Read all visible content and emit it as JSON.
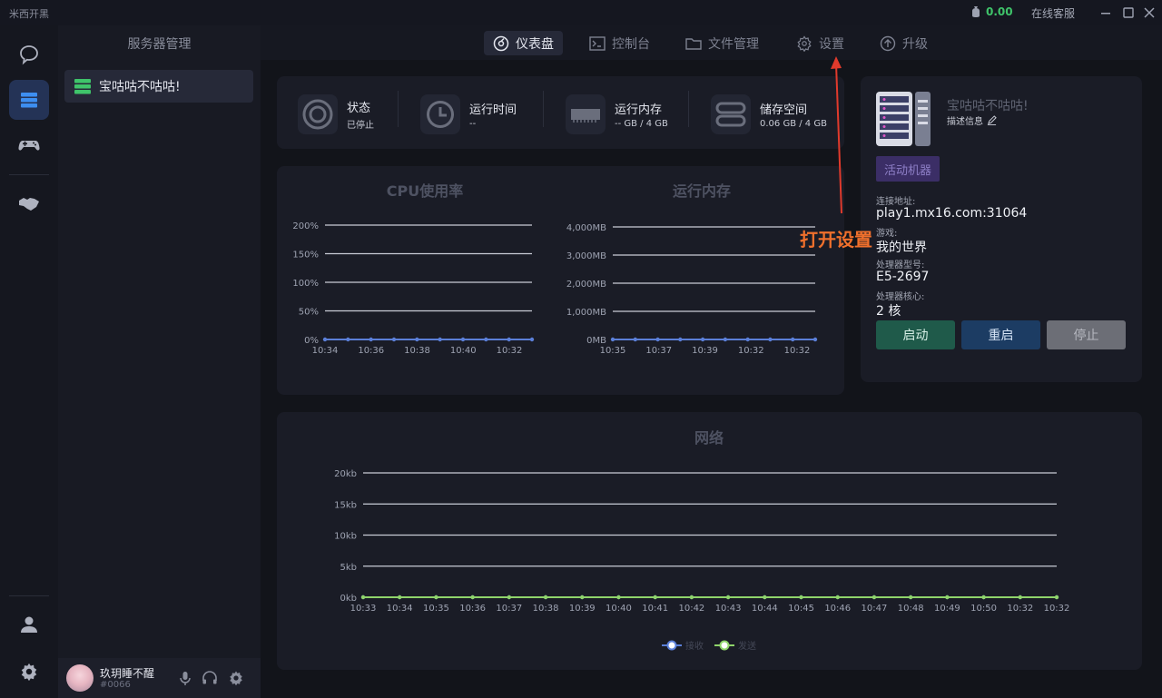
{
  "app": {
    "title": "米西开黑"
  },
  "titlebar": {
    "balance": "0.00",
    "support": "在线客服",
    "balance_color": "#3fc46a"
  },
  "rail": {
    "items": [
      "chat-icon",
      "server-icon",
      "gamepad-icon",
      "handshake-icon"
    ],
    "bottom": [
      "user-icon",
      "gear-icon"
    ]
  },
  "panel": {
    "title": "服务器管理",
    "server": {
      "name": "宝咕咕不咕咕!"
    },
    "user": {
      "name": "玖玥睡不醒",
      "id": "#0066"
    }
  },
  "nav": {
    "tabs": [
      {
        "label": "仪表盘",
        "icon": "dashboard-icon",
        "active": true
      },
      {
        "label": "控制台",
        "icon": "terminal-icon"
      },
      {
        "label": "文件管理",
        "icon": "folder-icon"
      },
      {
        "label": "设置",
        "icon": "gear-icon"
      },
      {
        "label": "升级",
        "icon": "upgrade-icon"
      }
    ]
  },
  "stats": [
    {
      "label": "状态",
      "value": "已停止",
      "icon": "status-icon"
    },
    {
      "label": "运行时间",
      "value": "--",
      "icon": "clock-icon"
    },
    {
      "label": "运行内存",
      "value": "-- GB / 4 GB",
      "icon": "ram-icon"
    },
    {
      "label": "储存空间",
      "value": "0.06 GB / 4 GB",
      "icon": "storage-icon"
    }
  ],
  "chart_data": [
    {
      "type": "line",
      "title": "CPU使用率",
      "x": [
        "10:34",
        "10:36",
        "10:38",
        "10:40",
        "10:32"
      ],
      "y_ticks": [
        "200%",
        "150%",
        "100%",
        "50%",
        "0%"
      ],
      "ylim": [
        0,
        200
      ],
      "series": [
        {
          "values": [
            0,
            0,
            0,
            0,
            0,
            0,
            0,
            0,
            0,
            0
          ],
          "color": "#5b7fd8"
        }
      ],
      "grid": true
    },
    {
      "type": "line",
      "title": "运行内存",
      "x": [
        "10:35",
        "10:37",
        "10:39",
        "10:32",
        "10:32"
      ],
      "y_ticks": [
        "4,000MB",
        "3,000MB",
        "2,000MB",
        "1,000MB",
        "0MB"
      ],
      "ylim": [
        0,
        4000
      ],
      "series": [
        {
          "values": [
            0,
            0,
            0,
            0,
            0,
            0,
            0,
            0,
            0,
            0
          ],
          "color": "#5b7fd8"
        }
      ],
      "grid": true
    },
    {
      "type": "line",
      "title": "网络",
      "x": [
        "10:33",
        "10:34",
        "10:35",
        "10:36",
        "10:37",
        "10:38",
        "10:39",
        "10:40",
        "10:41",
        "10:42",
        "10:43",
        "10:44",
        "10:45",
        "10:46",
        "10:47",
        "10:48",
        "10:49",
        "10:50",
        "10:32",
        "10:32"
      ],
      "y_ticks": [
        "20kb",
        "15kb",
        "10kb",
        "5kb",
        "0kb"
      ],
      "ylim": [
        0,
        20
      ],
      "series": [
        {
          "name": "接收",
          "values": [
            0,
            0,
            0,
            0,
            0,
            0,
            0,
            0,
            0,
            0,
            0,
            0,
            0,
            0,
            0,
            0,
            0,
            0,
            0,
            0
          ],
          "color": "#5b7fd8"
        },
        {
          "name": "发送",
          "values": [
            0,
            0,
            0,
            0,
            0,
            0,
            0,
            0,
            0,
            0,
            0,
            0,
            0,
            0,
            0,
            0,
            0,
            0,
            0,
            0
          ],
          "color": "#8fd46a"
        }
      ],
      "legend": "bottom",
      "grid": true
    }
  ],
  "server_info": {
    "name": "宝咕咕不咕咕!",
    "desc": "描述信息",
    "tag": "活动机器",
    "addr_label": "连接地址:",
    "addr": "play1.mx16.com:31064",
    "game_label": "游戏:",
    "game": "我的世界",
    "cpu_label": "处理器型号:",
    "cpu": "E5-2697",
    "cores_label": "处理器核心:",
    "cores": "2 核",
    "buttons": {
      "start": "启动",
      "restart": "重启",
      "stop": "停止"
    }
  },
  "annotation": {
    "text": "打开设置",
    "color": "#f0702c"
  }
}
